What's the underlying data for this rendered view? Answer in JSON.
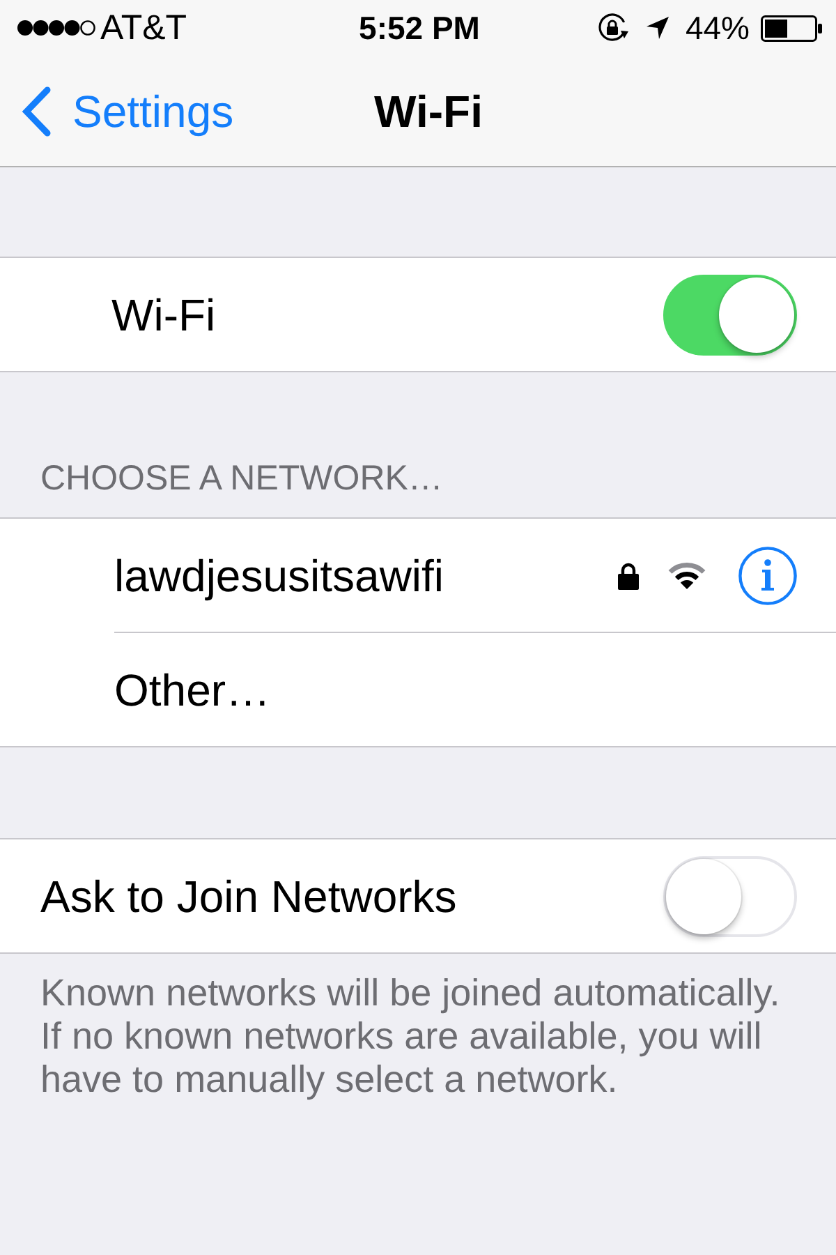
{
  "status_bar": {
    "carrier": "AT&T",
    "time": "5:52 PM",
    "battery": "44%"
  },
  "nav_bar": {
    "back": "Settings",
    "title": "Wi-Fi"
  },
  "wifi_setting": {
    "label": "Wi-Fi",
    "on": true
  },
  "networks_section": {
    "header": "CHOOSE A NETWORK…",
    "networks": [
      {
        "kind": "network",
        "name": "lawdjesusitsawifi",
        "locked": true
      },
      {
        "kind": "other",
        "name": "Other…"
      }
    ]
  },
  "ask_to_join": {
    "label": "Ask to Join Networks",
    "on": false,
    "footer": "Known networks will be joined automatically. If no known networks are available, you will have to manually select a network."
  }
}
